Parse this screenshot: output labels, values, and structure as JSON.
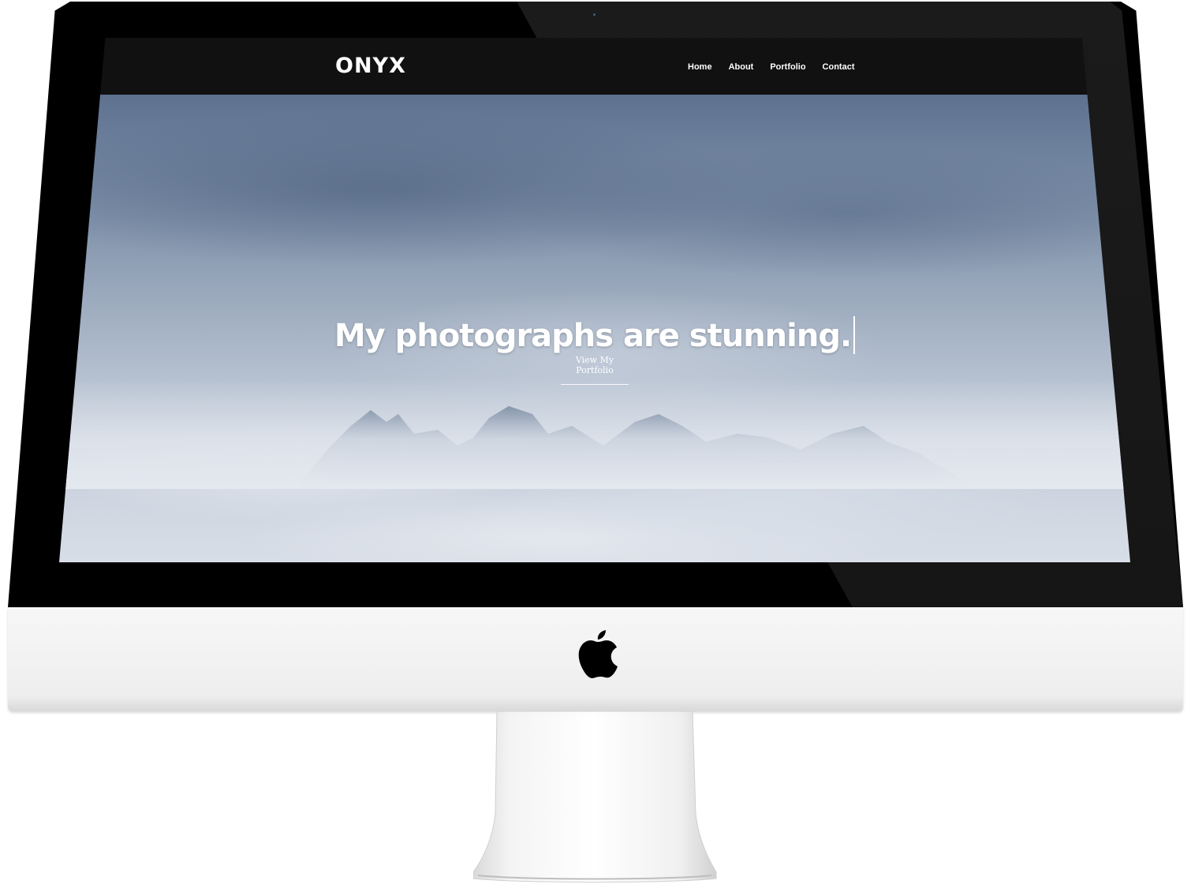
{
  "site": {
    "logo": "ONYX",
    "nav": [
      {
        "label": "Home"
      },
      {
        "label": "About"
      },
      {
        "label": "Portfolio"
      },
      {
        "label": "Contact"
      }
    ]
  },
  "hero": {
    "headline": "My photographs are stunning.",
    "cta_label": "View My Portfolio"
  },
  "device": {
    "logo_icon": "apple-logo-icon"
  },
  "colors": {
    "header_bg": "#111111",
    "text": "#ffffff",
    "bezel": "#000000"
  }
}
